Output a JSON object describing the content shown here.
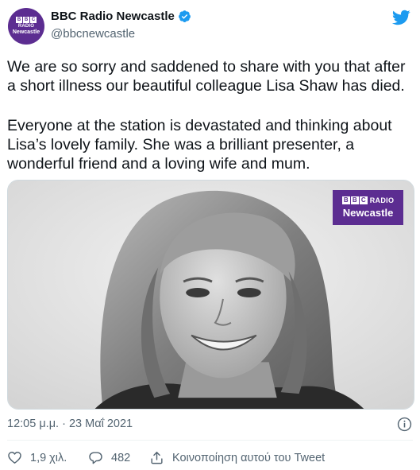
{
  "account": {
    "display_name": "BBC Radio Newcastle",
    "handle": "@bbcnewcastle",
    "avatar": {
      "bbc": [
        "B",
        "B",
        "C"
      ],
      "radio": "RADIO",
      "station": "Newcastle"
    },
    "verified_icon": "verified-badge-icon",
    "brand_color": "#5c2d91"
  },
  "tweet": {
    "paragraph1": "We are so sorry and saddened to share with you that after a short illness our beautiful colleague Lisa Shaw has died.",
    "paragraph2": "Everyone at the station is devastated and thinking about Lisa’s lovely family. She was a brilliant presenter, a wonderful friend and a loving wife and mum.",
    "timestamp": "12:05 μ.μ. · 23 Μαΐ 2021"
  },
  "media": {
    "logo": {
      "bbc": [
        "B",
        "B",
        "C"
      ],
      "radio": "RADIO",
      "station": "Newcastle"
    }
  },
  "actions": {
    "likes": "1,9 χιλ.",
    "replies": "482",
    "share": "Κοινοποίηση αυτού του Tweet"
  },
  "colors": {
    "accent": "#1d9bf0",
    "text": "#0f1419",
    "secondary": "#536471"
  }
}
